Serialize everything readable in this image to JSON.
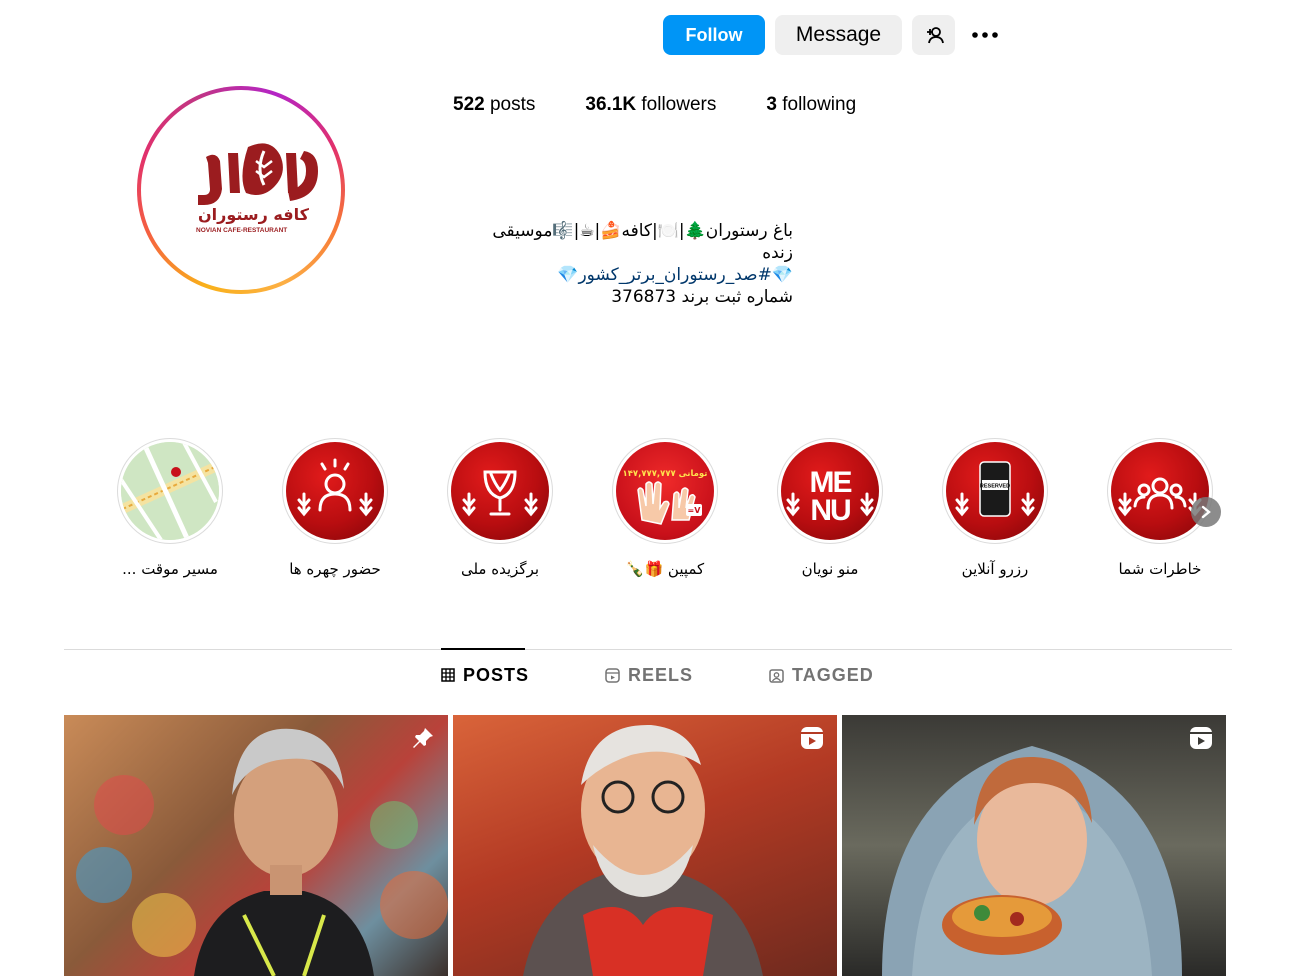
{
  "actions": {
    "follow_label": "Follow",
    "message_label": "Message"
  },
  "stats": {
    "posts_count": "522",
    "posts_label": "posts",
    "followers_count": "36.1K",
    "followers_label": "followers",
    "following_count": "3",
    "following_label": "following"
  },
  "avatar": {
    "logo_text_fa": "کافه رستوران",
    "logo_text_en": "NOVIAN CAFE-RESTAURANT"
  },
  "bio": {
    "line1": "باغ رستوران🌲|🍽️|کافه🍰|☕|🎼موسیقی زنده",
    "line2": "💎#صد_رستوران_برتر_کشور💎",
    "line3": "شماره ثبت برند 376873"
  },
  "highlights": [
    {
      "label": "خاطرات شما",
      "icon": "people-icon"
    },
    {
      "label": "رزرو آنلاین",
      "icon": "reserved-phone-icon",
      "image_text": "RESERVED"
    },
    {
      "label": "منو نویان",
      "icon": "menu-icon",
      "image_text": "MENU"
    },
    {
      "label": "کمپین 🎁🍾",
      "icon": "campaign-hands-icon",
      "image_text": "۱۴۷,۷۷۷,۷۷۷ تومانی"
    },
    {
      "label": "برگزیده ملی",
      "icon": "trophy-icon"
    },
    {
      "label": "حضور چهره ها",
      "icon": "person-icon"
    },
    {
      "label": "مسیر موقت ...",
      "icon": "map-icon"
    }
  ],
  "tabs": [
    {
      "label": "POSTS",
      "icon": "grid-icon",
      "active": true
    },
    {
      "label": "REELS",
      "icon": "reels-icon",
      "active": false
    },
    {
      "label": "TAGGED",
      "icon": "tagged-icon",
      "active": false
    }
  ],
  "posts": [
    {
      "badge": "pin-icon",
      "subject": "man with grey hair in black jacket"
    },
    {
      "badge": "reel-icon",
      "subject": "elderly man with glasses holding red paper"
    },
    {
      "badge": "reel-icon",
      "subject": "woman in headscarf eating pizza"
    }
  ],
  "colors": {
    "follow_blue": "#0095f6",
    "hashtag_blue": "#00376b",
    "brand_red": "#9b1c1f",
    "highlight_red": "#c8101a"
  }
}
